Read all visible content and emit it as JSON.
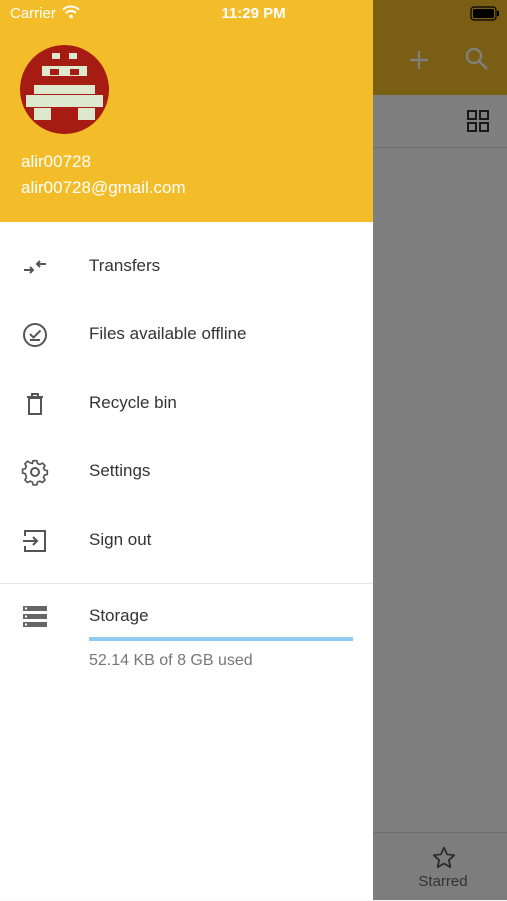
{
  "status_bar": {
    "carrier": "Carrier",
    "time": "11:29 PM"
  },
  "drawer": {
    "user": {
      "name": "alir00728",
      "email": "alir00728@gmail.com"
    },
    "menu": [
      {
        "label": "Transfers",
        "icon": "transfers-icon"
      },
      {
        "label": "Files available offline",
        "icon": "offline-check-icon"
      },
      {
        "label": "Recycle bin",
        "icon": "trash-icon"
      },
      {
        "label": "Settings",
        "icon": "gear-icon"
      },
      {
        "label": "Sign out",
        "icon": "sign-out-icon"
      }
    ],
    "storage": {
      "label": "Storage",
      "usage_text": "52.14 KB of 8 GB used",
      "used_fraction": 1.0
    }
  },
  "background": {
    "bottom_nav": {
      "starred_label": "Starred"
    }
  },
  "colors": {
    "accent": "#f3bd29",
    "storage_bar": "#8ecbef"
  }
}
